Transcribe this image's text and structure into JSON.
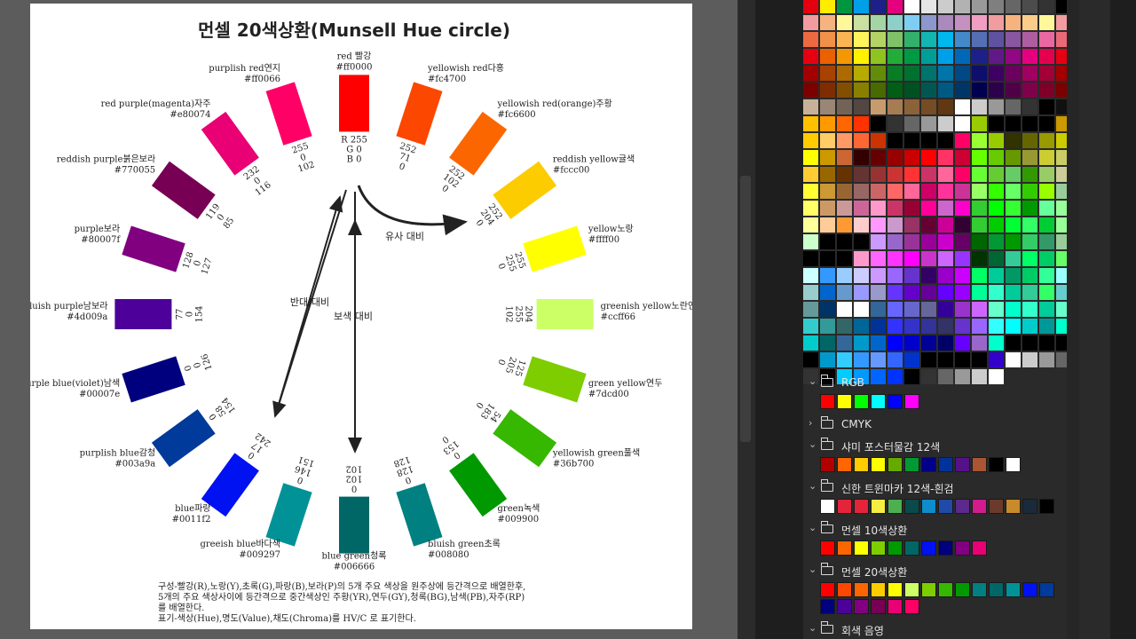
{
  "document": {
    "title": "먼셀 20색상환(Munsell Hue circle)",
    "hues": [
      {
        "name": "red 빨강",
        "hex": "#ff0000",
        "rgb": [
          "R 255",
          "G  0",
          "B  0"
        ]
      },
      {
        "name": "yellowish red다홍",
        "hex": "#fc4700",
        "rgb": [
          "252",
          "71",
          "0"
        ]
      },
      {
        "name": "yellowish red(orange)주황",
        "hex": "#fc6600",
        "rgb": [
          "252",
          "102",
          "0"
        ]
      },
      {
        "name": "reddish yellow귤색",
        "hex": "#fccc00",
        "rgb": [
          "252",
          "204",
          "0"
        ]
      },
      {
        "name": "yellow노랑",
        "hex": "#ffff00",
        "rgb": [
          "255",
          "255",
          "0"
        ]
      },
      {
        "name": "greenish yellow노란연두",
        "hex": "#ccff66",
        "rgb": [
          "204",
          "255",
          "102"
        ]
      },
      {
        "name": "green yellow연두",
        "hex": "#7dcd00",
        "rgb": [
          "125",
          "205",
          "0"
        ]
      },
      {
        "name": "yellowish green풀색",
        "hex": "#36b700",
        "rgb": [
          "54",
          "183",
          "0"
        ]
      },
      {
        "name": "green녹색",
        "hex": "#009900",
        "rgb": [
          "0",
          "153",
          "0"
        ]
      },
      {
        "name": "bluish green초록",
        "hex": "#008080",
        "rgb": [
          "0",
          "128",
          "128"
        ]
      },
      {
        "name": "blue green청록",
        "hex": "#006666",
        "rgb": [
          "0",
          "102",
          "102"
        ]
      },
      {
        "name": "greeish blue바다색",
        "hex": "#009297",
        "rgb": [
          "0",
          "146",
          "151"
        ]
      },
      {
        "name": "blue파랑",
        "hex": "#0011f2",
        "rgb": [
          "0",
          "17",
          "242"
        ]
      },
      {
        "name": "purplish blue감청",
        "hex": "#003a9a",
        "rgb": [
          "0",
          "58",
          "154"
        ]
      },
      {
        "name": "purple blue(violet)남색",
        "hex": "#00007e",
        "rgb": [
          "0",
          "0",
          "126"
        ]
      },
      {
        "name": "bluish purple남보라",
        "hex": "#4d009a",
        "rgb": [
          "77",
          "0",
          "154"
        ]
      },
      {
        "name": "purple보라",
        "hex": "#80007f",
        "rgb": [
          "128",
          "0",
          "127"
        ]
      },
      {
        "name": "reddish purple붉은보라",
        "hex": "#770055",
        "rgb": [
          "119",
          "0",
          "85"
        ]
      },
      {
        "name": "red purple(magenta)자주",
        "hex": "#e80074",
        "rgb": [
          "232",
          "0",
          "116"
        ]
      },
      {
        "name": "purplish red연지",
        "hex": "#ff0066",
        "rgb": [
          "255",
          "0",
          "102"
        ]
      }
    ],
    "labels": {
      "analog": "유사 대비",
      "complement": "보색 대비",
      "opposite": "반대/대비"
    },
    "notes": [
      "구성-빨강(R),노랑(Y),초록(G),파랑(B),보라(P)의 5개 주요 색상을 원주상에 등간격으로 배열한후,",
      "5개의 주요 색상사이에 등간격으로 중간색상인 주황(YR),연두(GY),청록(BG),남색(PB),자주(RP)",
      "를 배열한다.",
      "표기-색상(Hue),명도(Value),채도(Chroma)를  HV/C 로 표기한다."
    ]
  },
  "panel": {
    "grid_colors": [
      [
        "#e3000f",
        "#ffed00",
        "#009640",
        "#00a0e9",
        "#1d2088",
        "#e4007f",
        "#ffffff",
        "#e5e5e5",
        "#cccccc",
        "#b2b2b2",
        "#999999",
        "#7f7f7f",
        "#666666",
        "#4c4c4c",
        "#333333",
        "#000000"
      ],
      [
        "#f29c9f",
        "#f6b37f",
        "#fff799",
        "#c9e0a0",
        "#a3d6a3",
        "#8ecfc8",
        "#7ecef4",
        "#8c97cb",
        "#aa89bd",
        "#c490bf",
        "#f19ec2",
        "#f19c9f",
        "#f6b37f",
        "#facd89",
        "#fff799",
        "#f29c9f"
      ],
      [
        "#ec6941",
        "#f19149",
        "#f8b551",
        "#fff45c",
        "#b3d465",
        "#80c269",
        "#32b16c",
        "#13b5b1",
        "#00b7ee",
        "#448aca",
        "#556fb5",
        "#5f52a0",
        "#8957a1",
        "#ae5da1",
        "#ea68a2",
        "#eb6877"
      ],
      [
        "#e60012",
        "#eb6100",
        "#f39800",
        "#fff100",
        "#8fc31f",
        "#22ac38",
        "#009944",
        "#009e96",
        "#00a0e9",
        "#0068b7",
        "#1d2088",
        "#601986",
        "#920783",
        "#e4007f",
        "#e5004f",
        "#e60012"
      ],
      [
        "#a40000",
        "#a84200",
        "#ac6a00",
        "#b7aa00",
        "#638c0b",
        "#097c25",
        "#007130",
        "#00736d",
        "#0075a9",
        "#004986",
        "#0e0e6c",
        "#3e0062",
        "#6b005f",
        "#a0005f",
        "#a30037",
        "#a40000"
      ],
      [
        "#7d0000",
        "#7f2d00",
        "#834e00",
        "#8a8000",
        "#486a00",
        "#005e15",
        "#005121",
        "#005752",
        "#005982",
        "#003567",
        "#000050",
        "#2d004b",
        "#500047",
        "#7f004b",
        "#7e0029",
        "#7d0000"
      ],
      [
        "#c7b299",
        "#998675",
        "#736357",
        "#534741",
        "#c69c6d",
        "#a67c52",
        "#8c6239",
        "#754c24",
        "#603813",
        "#ffffff",
        "#cccccc",
        "#999999",
        "#666666",
        "#333333",
        "#000000",
        "#111111"
      ],
      [
        "#ffc000",
        "#ff9900",
        "#ff6600",
        "#ff3300",
        "#000000",
        "#333333",
        "#666666",
        "#999999",
        "#cccccc",
        "#ffffff",
        "#99cc00",
        "#000000",
        "#000000",
        "#000000",
        "#000000",
        "#cc9900"
      ],
      [
        "#ffcc00",
        "#ffcc66",
        "#ff9966",
        "#ff6633",
        "#cc3300",
        "#000000",
        "#000000",
        "#000000",
        "#000000",
        "#ff0066",
        "#99ff33",
        "#99cc00",
        "#333300",
        "#666600",
        "#999900",
        "#cccc00"
      ],
      [
        "#ffff00",
        "#cc9900",
        "#cc6633",
        "#330000",
        "#660000",
        "#990000",
        "#cc0000",
        "#ff0000",
        "#ff3366",
        "#cc0033",
        "#66ff00",
        "#66cc00",
        "#669900",
        "#999933",
        "#cccc33",
        "#cccc66"
      ],
      [
        "#ffcc33",
        "#996600",
        "#663300",
        "#663333",
        "#993333",
        "#cc3333",
        "#ff3333",
        "#cc3366",
        "#ff6699",
        "#ff0066",
        "#66ff33",
        "#66cc33",
        "#66cc66",
        "#339900",
        "#99cc66",
        "#cccc99"
      ],
      [
        "#ffff33",
        "#cc9933",
        "#996633",
        "#996666",
        "#cc6666",
        "#ff6666",
        "#ff6699",
        "#cc0066",
        "#ff3399",
        "#cc3399",
        "#99ff66",
        "#33ff00",
        "#66ff66",
        "#33cc00",
        "#99ff00",
        "#99cc99"
      ],
      [
        "#ffff66",
        "#cc9966",
        "#cc9999",
        "#cc6699",
        "#ff99cc",
        "#cc3366",
        "#990033",
        "#ff0099",
        "#cc66cc",
        "#ff00cc",
        "#33cc33",
        "#00ff00",
        "#33ff33",
        "#009900",
        "#66ff99",
        "#99ff99"
      ],
      [
        "#ffff99",
        "#ffcc99",
        "#ff9933",
        "#ffcccc",
        "#ff99ff",
        "#cc99cc",
        "#993366",
        "#660033",
        "#cc0099",
        "#330033",
        "#33cc33",
        "#00cc00",
        "#00ff33",
        "#33ff66",
        "#00cc33",
        "#99ff99"
      ],
      [
        "#ccffcc",
        "#000000",
        "#000000",
        "#000000",
        "#cc99ff",
        "#9966cc",
        "#993399",
        "#990099",
        "#cc00cc",
        "#660066",
        "#006600",
        "#009933",
        "#009900",
        "#33cc66",
        "#339966",
        "#99cc99"
      ],
      [
        "#000000",
        "#000000",
        "#000000",
        "#ff99cc",
        "#ff66ff",
        "#ff33ff",
        "#ff00ff",
        "#cc33cc",
        "#cc66ff",
        "#9933ff",
        "#003300",
        "#006633",
        "#33cc99",
        "#00ff66",
        "#00cc66",
        "#66ff66"
      ],
      [
        "#ccffff",
        "#3399ff",
        "#99ccff",
        "#ccccff",
        "#cc99ff",
        "#9966ff",
        "#6633cc",
        "#330066",
        "#9900cc",
        "#cc00ff",
        "#00ff66",
        "#00cc99",
        "#009966",
        "#00cc66",
        "#33ff99",
        "#99ffff"
      ],
      [
        "#99cccc",
        "#0066cc",
        "#6699cc",
        "#9999ff",
        "#9999cc",
        "#6633ff",
        "#6600cc",
        "#660099",
        "#6600ff",
        "#9900ff",
        "#00ff99",
        "#33ffcc",
        "#00cc99",
        "#33cc99",
        "#33ff66",
        "#66cccc"
      ],
      [
        "#669999",
        "#003366",
        "#ffffff",
        "#ffffff",
        "#336699",
        "#6666ff",
        "#6666cc",
        "#666699",
        "#330099",
        "#9933cc",
        "#cc66ff",
        "#66ffcc",
        "#00ffcc",
        "#33ffcc",
        "#00cc99",
        "#66ffcc"
      ],
      [
        "#33cccc",
        "#339999",
        "#336666",
        "#006699",
        "#003399",
        "#3333ff",
        "#3333cc",
        "#333399",
        "#333366",
        "#6633cc",
        "#9966ff",
        "#33ffff",
        "#00ffff",
        "#00cccc",
        "#009999",
        "#00ffcc"
      ],
      [
        "#00cccc",
        "#006666",
        "#336699",
        "#0099cc",
        "#0066cc",
        "#0000ff",
        "#0000cc",
        "#000099",
        "#000066",
        "#6600ff",
        "#9966cc",
        "#00ffcc",
        "#000000",
        "#000000",
        "#000000",
        "#000000"
      ],
      [
        "#000000",
        "#0099cc",
        "#33ccff",
        "#3399ff",
        "#6699ff",
        "#3366ff",
        "#0033cc",
        "#000000",
        "#000000",
        "#000000",
        "#000000",
        "#3300cc",
        "#ffffff",
        "#cccccc",
        "#999999",
        "#666666"
      ],
      [
        "#333333",
        "#000000",
        "#00ccff",
        "#0099ff",
        "#0066ff",
        "#0033ff",
        "#000000",
        "#333333",
        "#666666",
        "#999999",
        "#cccccc",
        "#ffffff",
        "#2a2a2a",
        "#2a2a2a",
        "#2a2a2a",
        "#2a2a2a"
      ]
    ],
    "groups": [
      {
        "name": "RGB",
        "expanded": true,
        "chevron": "⌄",
        "colors": [
          "#ff0000",
          "#ffff00",
          "#00ff00",
          "#00ffff",
          "#0000ff",
          "#ff00ff"
        ]
      },
      {
        "name": "CMYK",
        "expanded": false,
        "chevron": "›",
        "colors": []
      },
      {
        "name": "샤미 포스터물감 12색",
        "expanded": true,
        "chevron": "⌄",
        "colors": [
          "#b00000",
          "#ff6600",
          "#ffcc00",
          "#ffff00",
          "#66aa00",
          "#009933",
          "#000088",
          "#003399",
          "#551188",
          "#aa5533",
          "#000000",
          "#ffffff"
        ]
      },
      {
        "name": "신한 트윈마카 12색-흰검",
        "expanded": true,
        "chevron": "⌄",
        "colors": [
          "#ffffff",
          "#e3243b",
          "#e3243b",
          "#f7ec42",
          "#4caf50",
          "#0a4a4a",
          "#0e8ccc",
          "#1f4aa8",
          "#5b2a8c",
          "#d11b8e",
          "#6b3a2a",
          "#c88a2a",
          "#1a2a3a",
          "#000000"
        ]
      },
      {
        "name": "먼셀 10색상환",
        "expanded": true,
        "chevron": "⌄",
        "colors": [
          "#ff0000",
          "#fc6600",
          "#ffff00",
          "#7dcd00",
          "#009900",
          "#006666",
          "#0011f2",
          "#00007e",
          "#80007f",
          "#e80074"
        ]
      },
      {
        "name": "먼셀 20색상환",
        "expanded": true,
        "chevron": "⌄",
        "colors": [
          "#ff0000",
          "#fc4700",
          "#fc6600",
          "#fccc00",
          "#ffff00",
          "#ccff66",
          "#7dcd00",
          "#36b700",
          "#009900",
          "#008080",
          "#006666",
          "#009297",
          "#0011f2",
          "#003a9a",
          "#00007e",
          "#4d009a",
          "#80007f",
          "#770055",
          "#e80074",
          "#ff0066"
        ]
      },
      {
        "name": "회색 음영",
        "expanded": true,
        "chevron": "⌄",
        "colors": []
      }
    ]
  }
}
